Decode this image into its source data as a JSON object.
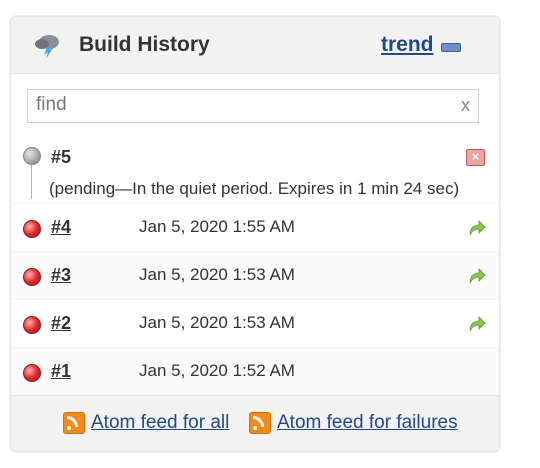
{
  "header": {
    "title": "Build History",
    "trend_label": "trend"
  },
  "search": {
    "placeholder": "find",
    "clear_label": "x"
  },
  "pending": {
    "number": "#5",
    "message": "(pending—In the quiet period. Expires in 1 min 24 sec)",
    "cancel_label": "×"
  },
  "builds": [
    {
      "number": "#4",
      "date": "Jan 5, 2020 1:55 AM",
      "status": "failed",
      "rebuild": true
    },
    {
      "number": "#3",
      "date": "Jan 5, 2020 1:53 AM",
      "status": "failed",
      "rebuild": true
    },
    {
      "number": "#2",
      "date": "Jan 5, 2020 1:53 AM",
      "status": "failed",
      "rebuild": true
    },
    {
      "number": "#1",
      "date": "Jan 5, 2020 1:52 AM",
      "status": "failed",
      "rebuild": false
    }
  ],
  "footer": {
    "feed_all_label": "Atom feed for all",
    "feed_failures_label": "Atom feed for failures"
  },
  "colors": {
    "link": "#204a87",
    "failed_ball": "#e02b2b",
    "pending_ball": "#a9a9a9",
    "rss": "#f28a1a"
  }
}
